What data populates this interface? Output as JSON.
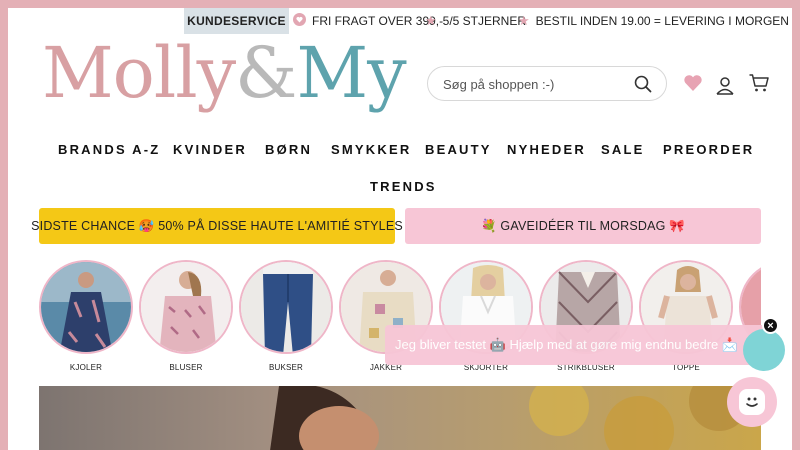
{
  "topbar": {
    "kundeservice": "KUNDESERVICE",
    "usp": [
      {
        "icon": "heart-circle-icon",
        "text": "FRI FRAGT OVER 399,-"
      },
      {
        "icon": "star-icon",
        "text": "5/5 STJERNER"
      },
      {
        "icon": "star-icon",
        "text": "BESTIL INDEN 19.00 = LEVERING I MORGEN"
      }
    ]
  },
  "logo": {
    "part1": "Molly",
    "part2": "&",
    "part3": "My"
  },
  "search": {
    "placeholder": "Søg på shoppen :-)"
  },
  "nav": {
    "items": [
      "BRANDS A-Z",
      "KVINDER",
      "BØRN",
      "SMYKKER",
      "BEAUTY",
      "NYHEDER",
      "SALE",
      "PREORDER",
      "TRENDS"
    ]
  },
  "banners": {
    "left": "SIDSTE CHANCE 🥵 50% PÅ DISSE HAUTE L'AMITIÉ STYLES",
    "right": "💐 GAVEIDÉER TIL MORSDAG 🎀"
  },
  "categories": [
    {
      "label": "KJOLER"
    },
    {
      "label": "BLUSER"
    },
    {
      "label": "BUKSER"
    },
    {
      "label": "JAKKER"
    },
    {
      "label": "SKJORTER"
    },
    {
      "label": "STRIKBLUSER"
    },
    {
      "label": "TOPPE"
    },
    {
      "label": ""
    }
  ],
  "popup": {
    "text": "Jeg bliver testet 🤖 Hjælp med at gøre mig endnu bedre 📩",
    "close": "×"
  },
  "colors": {
    "frame": "#e4b0b6",
    "logo_pink": "#d8a0a3",
    "logo_gray": "#b9b9b9",
    "logo_teal": "#5ea3ad",
    "banner_yellow": "#f4c816",
    "banner_pink": "#f7c6d6",
    "kundeservice_bg": "#d9e1e6"
  }
}
